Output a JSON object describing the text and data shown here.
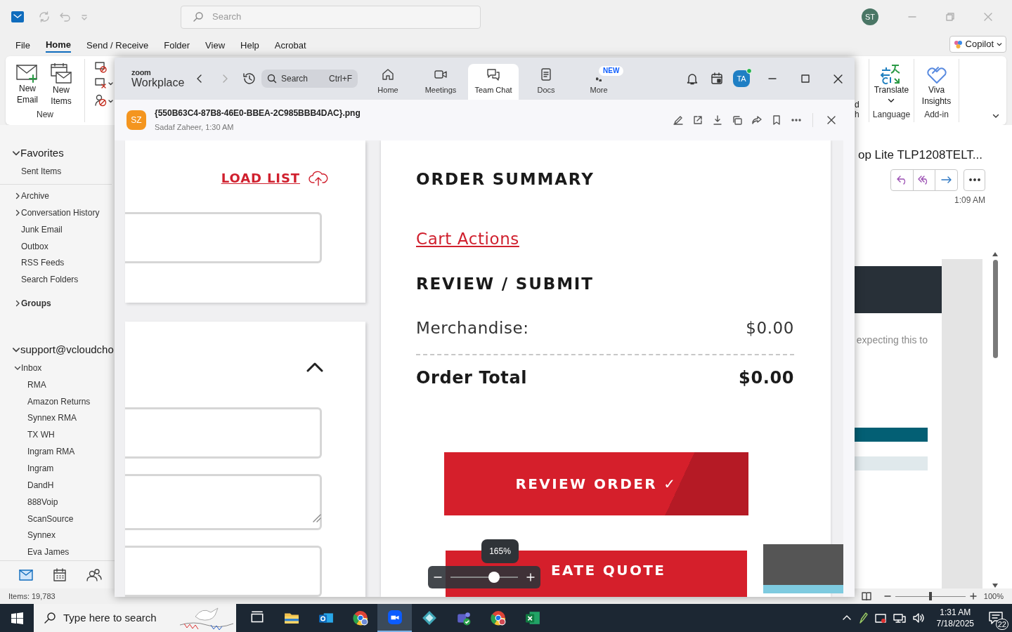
{
  "outlook": {
    "search_placeholder": "Search",
    "account_initials": "ST",
    "menu_tabs": [
      {
        "label": "File",
        "selected": false
      },
      {
        "label": "Home",
        "selected": true
      },
      {
        "label": "Send / Receive",
        "selected": false
      },
      {
        "label": "Folder",
        "selected": false
      },
      {
        "label": "View",
        "selected": false
      },
      {
        "label": "Help",
        "selected": false
      },
      {
        "label": "Acrobat",
        "selected": false
      }
    ],
    "copilot": "Copilot",
    "ribbon": {
      "new_email": "New Email",
      "new_items": "New Items",
      "group_new": "New",
      "cut_top": "d",
      "cut_bottom": "h",
      "translate": "Translate",
      "group_language": "Language",
      "viva": "Viva Insights",
      "group_addin": "Add-in"
    },
    "folder_tree": [
      {
        "label": "Favorites",
        "kind": "header",
        "expanded": true,
        "children": [
          {
            "label": "Sent Items"
          }
        ]
      },
      {
        "label": "Archive",
        "expanded": false
      },
      {
        "label": "Conversation History",
        "expanded": false
      },
      {
        "label": "Junk Email"
      },
      {
        "label": "Outbox"
      },
      {
        "label": "RSS Feeds"
      },
      {
        "label": "Search Folders"
      },
      {
        "label": "Groups",
        "kind": "group",
        "expanded": false
      },
      {
        "label": "support@vcloudcho",
        "kind": "header",
        "expanded": true,
        "children": [
          {
            "label": "Inbox",
            "expanded": true,
            "children": [
              {
                "label": "RMA"
              },
              {
                "label": "Amazon Returns"
              },
              {
                "label": "Synnex RMA"
              },
              {
                "label": "TX WH"
              },
              {
                "label": "Ingram RMA"
              },
              {
                "label": "Ingram"
              },
              {
                "label": "DandH"
              },
              {
                "label": "888Voip"
              },
              {
                "label": "ScanSource"
              },
              {
                "label": "Synnex"
              },
              {
                "label": "Eva James"
              }
            ]
          }
        ]
      }
    ],
    "reading_pane": {
      "subject": "op Lite TLP1208TELT...",
      "time": "1:09 AM",
      "body_text": "expecting this to"
    },
    "status_bar": {
      "items": "Items: 19,783",
      "zoom": "100%",
      "level": 0.5
    }
  },
  "zoom": {
    "brand_small": "zoom",
    "brand": "Workplace",
    "search": "Search",
    "shortcut": "Ctrl+F",
    "nav_tabs": [
      {
        "label": "Home",
        "selected": false
      },
      {
        "label": "Meetings",
        "selected": false
      },
      {
        "label": "Team Chat",
        "selected": true
      },
      {
        "label": "Docs",
        "selected": false
      },
      {
        "label": "More",
        "selected": false,
        "badge": "NEW"
      }
    ],
    "avatar": "TA",
    "online": true,
    "file": {
      "avatar": "SZ",
      "name": "{550B63C4-87B8-46E0-BBEA-2C985BBB4DAC}.png",
      "meta": "Sadaf Zaheer, 1:30 AM"
    },
    "image": {
      "load_list": "LOAD LIST",
      "order_summary": "ORDER SUMMARY",
      "cart_actions": "Cart Actions",
      "review_submit": "REVIEW / SUBMIT",
      "merchandise_label": "Merchandise:",
      "merchandise_value": "$0.00",
      "total_label": "Order Total",
      "total_value": "$0.00",
      "review_order": "REVIEW ORDER ✓",
      "create_quote": "EATE QUOTE"
    },
    "zoom_level": "165%",
    "level": 0.65
  },
  "taskbar": {
    "search_placeholder": "Type here to search",
    "apps": [
      {
        "selected": false
      },
      {
        "selected": false
      },
      {
        "selected": false
      },
      {
        "selected": false
      },
      {
        "selected": true
      },
      {
        "selected": false
      },
      {
        "selected": false
      },
      {
        "selected": false
      },
      {
        "selected": false
      }
    ],
    "time": "1:31 AM",
    "date": "7/18/2025",
    "notifications": "22"
  }
}
